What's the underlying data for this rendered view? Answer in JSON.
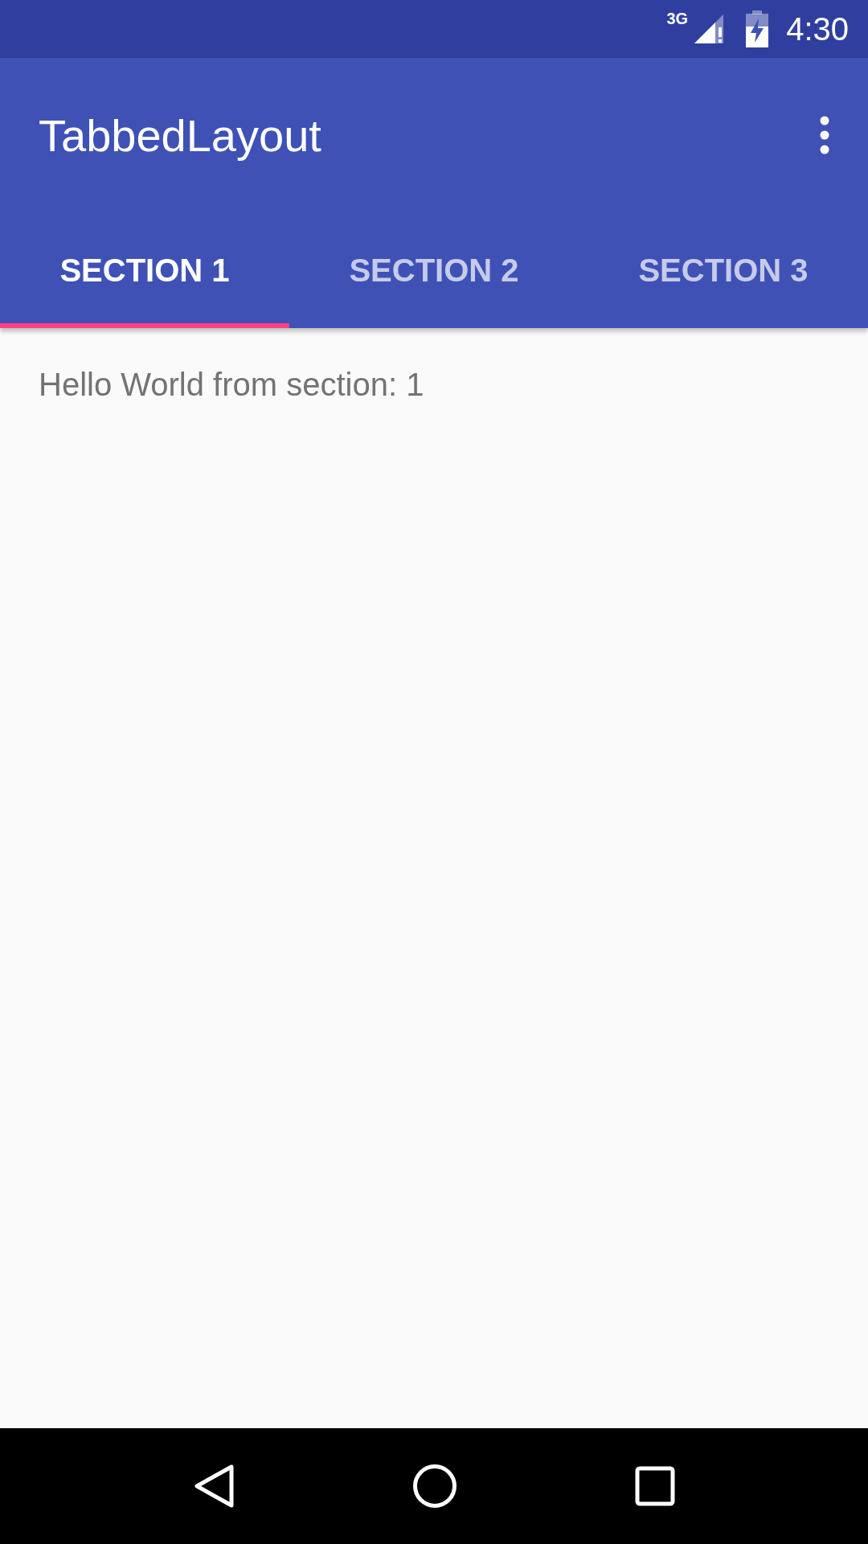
{
  "status_bar": {
    "network": "3G",
    "time": "4:30"
  },
  "app_bar": {
    "title": "TabbedLayout"
  },
  "tabs": [
    {
      "label": "SECTION 1",
      "selected": true
    },
    {
      "label": "SECTION 2",
      "selected": false
    },
    {
      "label": "SECTION 3",
      "selected": false
    }
  ],
  "content": {
    "text": "Hello World from section: 1"
  }
}
